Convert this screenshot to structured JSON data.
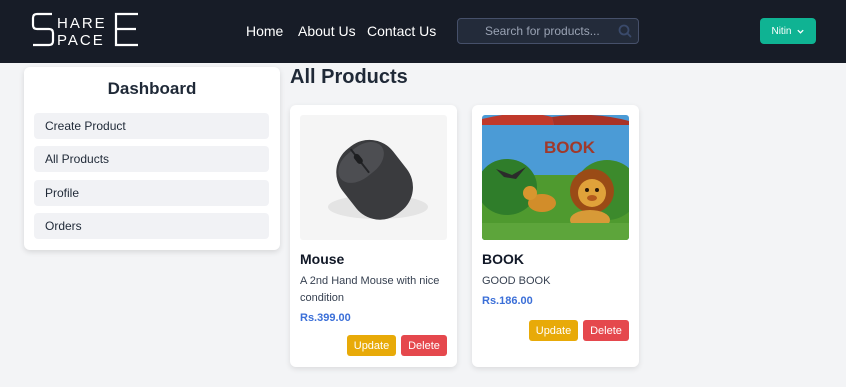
{
  "nav": {
    "logo_top": "HARE",
    "logo_bottom": "PACE",
    "links": [
      "Home",
      "About Us",
      "Contact Us"
    ],
    "search_placeholder": "Search for products...",
    "user_name": "Nitin"
  },
  "sidebar": {
    "title": "Dashboard",
    "items": [
      "Create Product",
      "All Products",
      "Profile",
      "Orders"
    ]
  },
  "main": {
    "title": "All Products",
    "products": [
      {
        "name": "Mouse",
        "description": "A 2nd Hand Mouse with nice condition",
        "price": "Rs.399.00",
        "update_label": "Update",
        "delete_label": "Delete"
      },
      {
        "name": "BOOK",
        "description": "GOOD BOOK",
        "price": "Rs.186.00",
        "update_label": "Update",
        "delete_label": "Delete",
        "image_text": "BOOK"
      }
    ]
  },
  "colors": {
    "navbar": "#171c27",
    "user_button": "#0fb393",
    "update": "#e8aa08",
    "delete": "#e5484d",
    "price": "#3b6fd8"
  }
}
